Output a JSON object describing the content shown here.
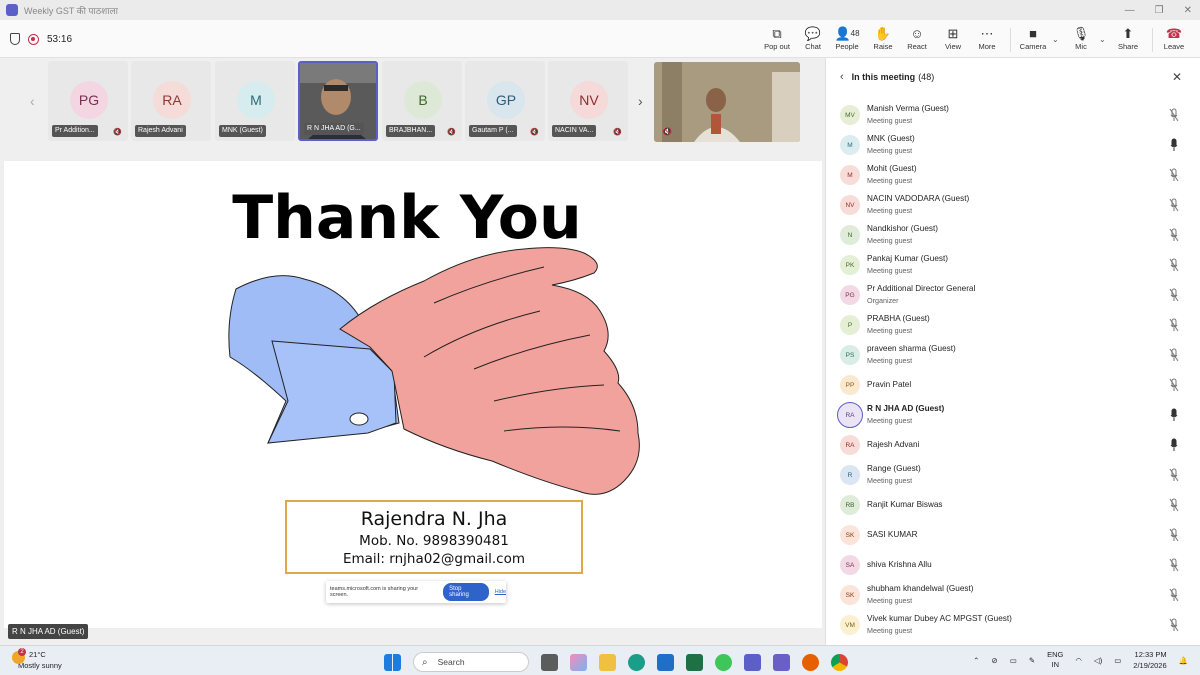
{
  "window": {
    "title": "Weekly GST की पाठशाला"
  },
  "toolbar": {
    "timer": "53:16",
    "buttons": [
      {
        "label": "Pop out",
        "icon": "pop-out-icon"
      },
      {
        "label": "Chat",
        "icon": "chat-icon"
      },
      {
        "label": "People",
        "icon": "people-icon",
        "count": "48"
      },
      {
        "label": "Raise",
        "icon": "raise-hand-icon"
      },
      {
        "label": "React",
        "icon": "react-icon"
      },
      {
        "label": "View",
        "icon": "view-icon"
      },
      {
        "label": "More",
        "icon": "more-icon"
      },
      {
        "label": "Camera",
        "icon": "camera-icon"
      },
      {
        "label": "Mic",
        "icon": "mic-off-icon"
      },
      {
        "label": "Share",
        "icon": "share-icon"
      },
      {
        "label": "Leave",
        "icon": "leave-phone-icon"
      }
    ]
  },
  "thumbnails": [
    {
      "initials": "PG",
      "name": "Pr Addition...",
      "color": "#f3d6e2",
      "fg": "#7a3050"
    },
    {
      "initials": "RA",
      "name": "Rajesh Advani",
      "color": "#f6dcd9",
      "fg": "#8a3a32"
    },
    {
      "initials": "M",
      "name": "MNK (Guest)",
      "color": "#d7ecef",
      "fg": "#2d6b75"
    },
    {
      "initials": "",
      "name": "R N JHA AD (G...",
      "color": "#6e6e6e",
      "fg": "#fff"
    },
    {
      "initials": "B",
      "name": "BRAJBHAN...",
      "color": "#dde9d6",
      "fg": "#3d6630"
    },
    {
      "initials": "GP",
      "name": "Gautam P (...",
      "color": "#d9e6ee",
      "fg": "#2f5b78"
    },
    {
      "initials": "NV",
      "name": "NACIN VA...",
      "color": "#f6d9d9",
      "fg": "#8c2f2f"
    }
  ],
  "slide": {
    "title": "Thank You",
    "name": "Rajendra N. Jha",
    "mobile": "Mob. No. 9898390481",
    "email": "Email: rnjha02@gmail.com"
  },
  "share_bar": {
    "message": "teams.microsoft.com is sharing your screen.",
    "stop_label": "Stop sharing",
    "hide_label": "Hide"
  },
  "speaker_label": "R N JHA AD (Guest)",
  "panel": {
    "title": "In this meeting",
    "count": "(48)",
    "participants": [
      {
        "initials": "MV",
        "name": "Manish Verma (Guest)",
        "sub": "Meeting guest",
        "bg": "#e6eed6",
        "fg": "#4b6b2b",
        "mic": "off"
      },
      {
        "initials": "M",
        "name": "MNK (Guest)",
        "sub": "Meeting guest",
        "bg": "#dbedf1",
        "fg": "#2d6b75",
        "mic": "on"
      },
      {
        "initials": "M",
        "name": "Mohit (Guest)",
        "sub": "Meeting guest",
        "bg": "#f8dcd8",
        "fg": "#8c2f2f",
        "mic": "off"
      },
      {
        "initials": "NV",
        "name": "NACIN VADODARA (Guest)",
        "sub": "Meeting guest",
        "bg": "#f8dcd8",
        "fg": "#8c2f2f",
        "mic": "off"
      },
      {
        "initials": "N",
        "name": "Nandkishor (Guest)",
        "sub": "Meeting guest",
        "bg": "#e0ecd9",
        "fg": "#3d6630",
        "mic": "off"
      },
      {
        "initials": "PK",
        "name": "Pankaj Kumar (Guest)",
        "sub": "Meeting guest",
        "bg": "#e4efd6",
        "fg": "#4b6b2b",
        "mic": "off"
      },
      {
        "initials": "PG",
        "name": "Pr Additional Director General",
        "sub": "Organizer",
        "bg": "#f3d9e4",
        "fg": "#7a3050",
        "mic": "off"
      },
      {
        "initials": "P",
        "name": "PRABHA (Guest)",
        "sub": "Meeting guest",
        "bg": "#e4efd6",
        "fg": "#4b6b2b",
        "mic": "off"
      },
      {
        "initials": "PS",
        "name": "praveen sharma (Guest)",
        "sub": "Meeting guest",
        "bg": "#d9ede6",
        "fg": "#2d6b55",
        "mic": "off"
      },
      {
        "initials": "PP",
        "name": "Pravin Patel",
        "sub": "",
        "bg": "#fbe9cf",
        "fg": "#8a5a17",
        "mic": "off"
      },
      {
        "initials": "RA",
        "name": "R N JHA AD (Guest)",
        "sub": "Meeting guest",
        "bg": "#eae4f5",
        "fg": "#5b3f8a",
        "mic": "on",
        "ring": true,
        "bold": true
      },
      {
        "initials": "RA",
        "name": "Rajesh Advani",
        "sub": "",
        "bg": "#f8dcd8",
        "fg": "#8c2f2f",
        "mic": "on"
      },
      {
        "initials": "R",
        "name": "Range (Guest)",
        "sub": "Meeting guest",
        "bg": "#dbe6f3",
        "fg": "#2f5b78",
        "mic": "off"
      },
      {
        "initials": "RB",
        "name": "Ranjit Kumar Biswas",
        "sub": "",
        "bg": "#e0ecd9",
        "fg": "#3d6630",
        "mic": "off"
      },
      {
        "initials": "SK",
        "name": "SASI KUMAR",
        "sub": "",
        "bg": "#fbe4d9",
        "fg": "#8a3a17",
        "mic": "off"
      },
      {
        "initials": "SA",
        "name": "shiva Krishna Allu",
        "sub": "",
        "bg": "#f3d9e4",
        "fg": "#7a3050",
        "mic": "off"
      },
      {
        "initials": "SK",
        "name": "shubham khandelwal (Guest)",
        "sub": "Meeting guest",
        "bg": "#fbe4d9",
        "fg": "#8a3a17",
        "mic": "off"
      },
      {
        "initials": "VM",
        "name": "Vivek kumar Dubey AC MPGST (Guest)",
        "sub": "Meeting guest",
        "bg": "#fbf0cf",
        "fg": "#7a6017",
        "mic": "off"
      }
    ]
  },
  "taskbar": {
    "weather_badge": "2",
    "temperature": "21°C",
    "condition": "Mostly sunny",
    "search_placeholder": "Search",
    "lang_top": "ENG",
    "lang_bottom": "IN",
    "time": "12:33 PM",
    "date": "2/19/2026"
  }
}
